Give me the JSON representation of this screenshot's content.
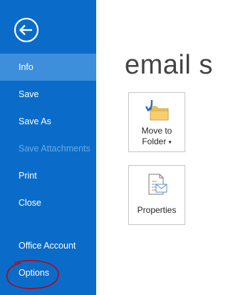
{
  "sidebar": {
    "items": [
      {
        "label": "Info"
      },
      {
        "label": "Save"
      },
      {
        "label": "Save As"
      },
      {
        "label": "Save Attachments"
      },
      {
        "label": "Print"
      },
      {
        "label": "Close"
      },
      {
        "label": "Office Account"
      },
      {
        "label": "Options"
      }
    ],
    "active_item": "Info",
    "disabled_items": [
      "Save Attachments"
    ]
  },
  "main": {
    "title": "email s",
    "tiles": [
      {
        "label_line1": "Move to",
        "label_line2": "Folder",
        "icon": "move-to-folder-icon",
        "has_dropdown": true
      },
      {
        "label_line1": "Properties",
        "icon": "properties-icon"
      }
    ]
  },
  "colors": {
    "sidebar_bg": "#0a6cc8",
    "active_item_bg": "#3d8fdb",
    "disabled_text": "#6aa8e4",
    "annotation": "#c0001a"
  },
  "annotation": {
    "shape": "hand-drawn-ellipse",
    "target": "Options"
  }
}
